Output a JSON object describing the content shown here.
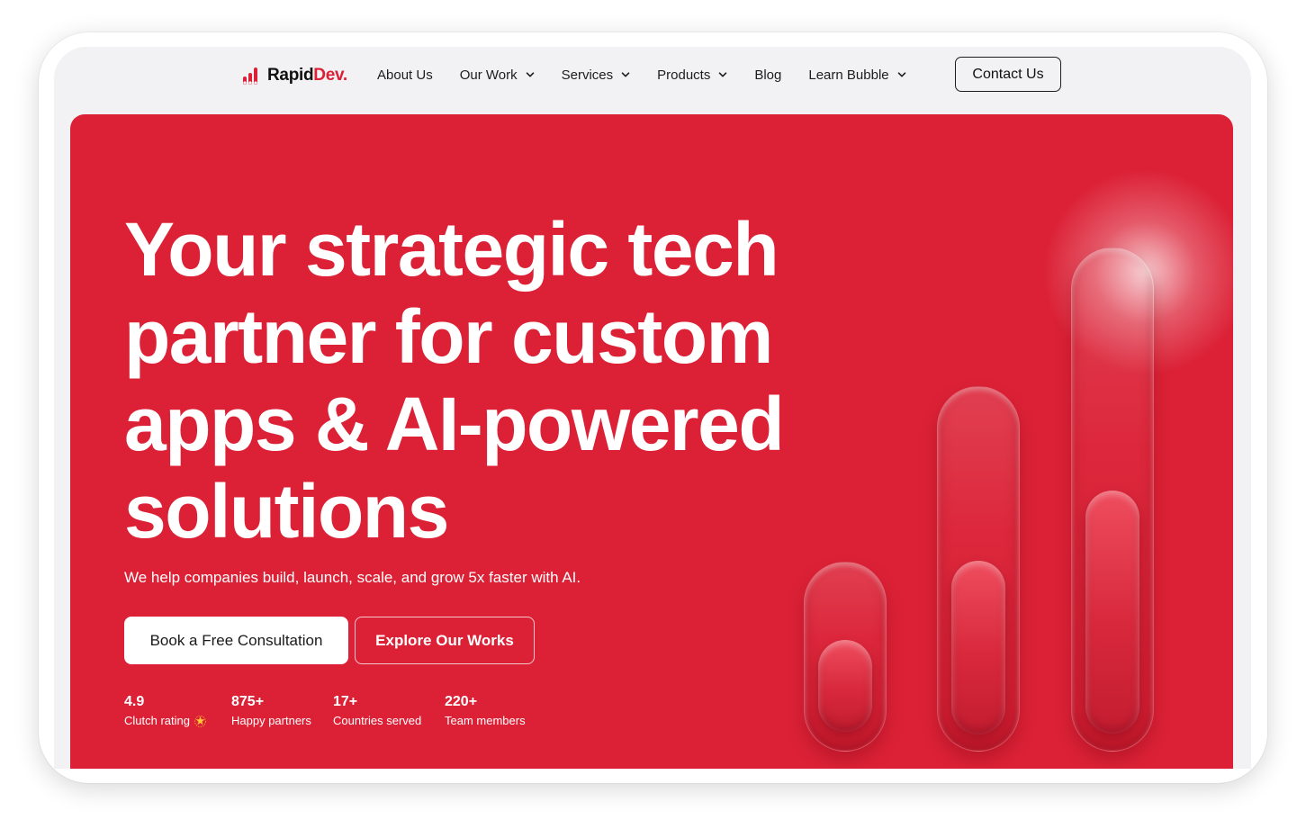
{
  "brand": {
    "name_part1": "Rapid",
    "name_part2": "Dev.",
    "accent_color": "#dc2136"
  },
  "nav": {
    "items": [
      {
        "label": "About Us",
        "has_dropdown": false
      },
      {
        "label": "Our Work",
        "has_dropdown": true
      },
      {
        "label": "Services",
        "has_dropdown": true
      },
      {
        "label": "Products",
        "has_dropdown": true
      },
      {
        "label": "Blog",
        "has_dropdown": false
      },
      {
        "label": "Learn Bubble",
        "has_dropdown": true
      }
    ],
    "contact_label": "Contact Us"
  },
  "hero": {
    "headline_lines": [
      "Your strategic tech",
      "partner for custom",
      "apps & AI-powered",
      "solutions"
    ],
    "subheadline": "We help companies build, launch, scale, and grow 5x faster with AI.",
    "primary_cta": "Book a Free Consultation",
    "secondary_cta": "Explore Our Works",
    "background_color": "#dc2136",
    "stats": [
      {
        "value": "4.9",
        "label": "Clutch rating",
        "icon": "star-icon"
      },
      {
        "value": "875+",
        "label": "Happy partners"
      },
      {
        "value": "17+",
        "label": "Countries served"
      },
      {
        "value": "220+",
        "label": "Team members"
      }
    ]
  }
}
